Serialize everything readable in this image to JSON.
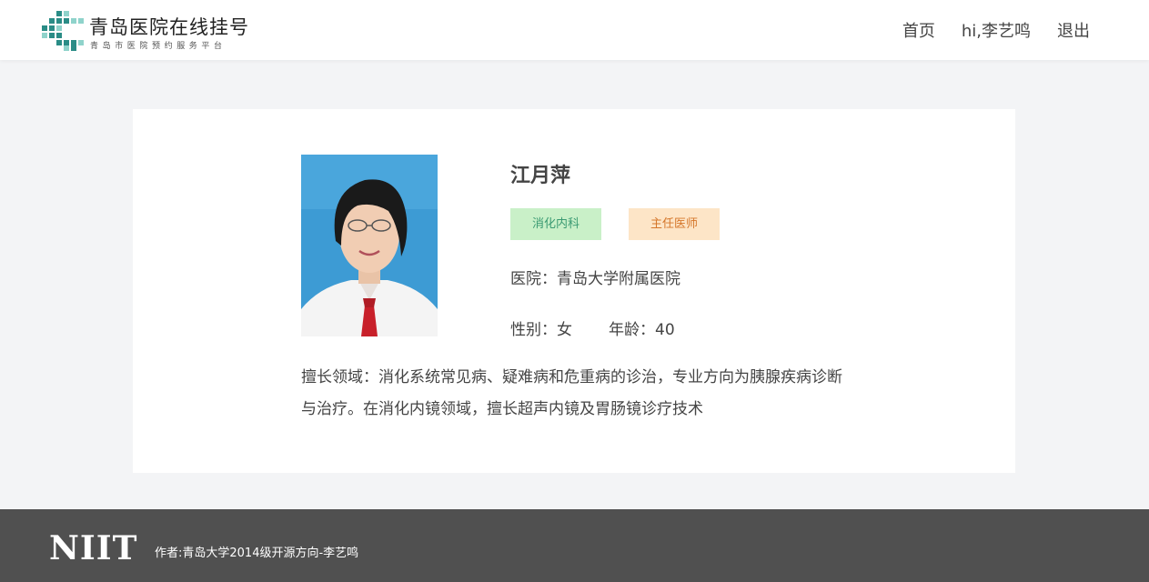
{
  "header": {
    "logo_title": "青岛医院在线挂号",
    "logo_subtitle": "青岛市医院预约服务平台",
    "nav": {
      "home": "首页",
      "user": "hi,李艺鸣",
      "logout": "退出"
    }
  },
  "doctor": {
    "name": "江月萍",
    "department_tag": "消化内科",
    "title_tag": "主任医师",
    "hospital_label": "医院：",
    "hospital": "青岛大学附属医院",
    "gender_label": "性别：",
    "gender": "女",
    "age_label": "年龄：",
    "age": "40",
    "specialty": "擅长领域：消化系统常见病、疑难病和危重病的诊治，专业方向为胰腺疾病诊断与治疗。在消化内镜领域，擅长超声内镜及胃肠镜诊疗技术"
  },
  "footer": {
    "logo_text": "NIIT",
    "author": "作者:青岛大学2014级开源方向-李艺鸣"
  },
  "colors": {
    "logo_teal": "#2a8c86",
    "logo_light": "#8fd3cb",
    "tag_dept_bg": "#c9f0c8",
    "tag_dept_text": "#3a9a72",
    "tag_title_bg": "#fde5c7",
    "tag_title_text": "#d5762a",
    "footer_bg": "#505050"
  }
}
